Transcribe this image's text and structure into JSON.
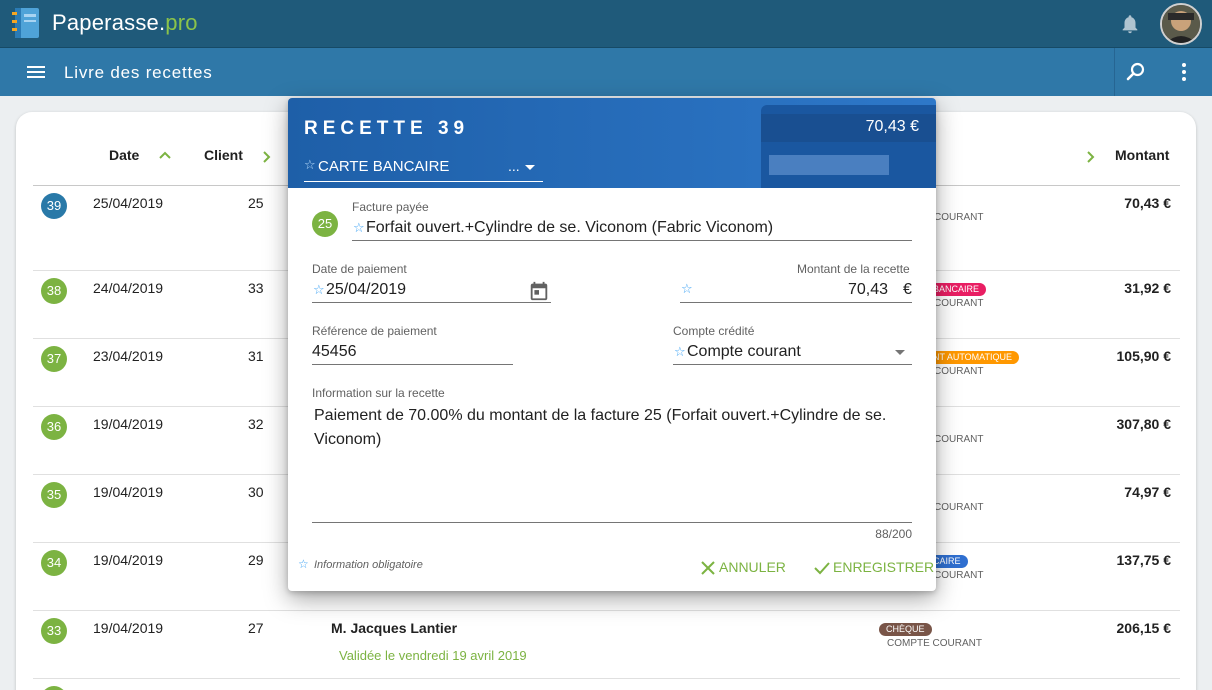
{
  "app": {
    "brand_main": "Paperasse.",
    "brand_accent": "pro",
    "page_title": "Livre des recettes"
  },
  "colors": {
    "topbar": "#1f5a7a",
    "toolbar": "#2f78a8",
    "accent_green": "#7cb342",
    "selected_blue": "#2979a8",
    "dialog_header": "#1e5fa8"
  },
  "table": {
    "headers": {
      "date": "Date",
      "client": "Client",
      "montant": "Montant"
    },
    "rows": [
      {
        "num": "39",
        "date": "25/04/2019",
        "client": "25",
        "amount": "70,43 €",
        "badge": "",
        "compte": "COURANT"
      },
      {
        "num": "38",
        "date": "24/04/2019",
        "client": "33",
        "amount": "31,92 €",
        "badge": "BANCAIRE",
        "compte": "COURANT"
      },
      {
        "num": "37",
        "date": "23/04/2019",
        "client": "31",
        "amount": "105,90 €",
        "badge": "NT AUTOMATIQUE",
        "compte": "COURANT"
      },
      {
        "num": "36",
        "date": "19/04/2019",
        "client": "32",
        "amount": "307,80 €",
        "badge": "",
        "compte": "COURANT"
      },
      {
        "num": "35",
        "date": "19/04/2019",
        "client": "30",
        "amount": "74,97 €",
        "badge": "",
        "compte": "COURANT"
      },
      {
        "num": "34",
        "date": "19/04/2019",
        "client": "29",
        "amount": "137,75 €",
        "badge": "CAIRE",
        "compte": "COURANT"
      },
      {
        "num": "33",
        "date": "19/04/2019",
        "client": "27",
        "amount": "206,15 €",
        "badge": "CHÈQUE",
        "compte": "COMPTE COURANT",
        "name": "M. Jacques Lantier",
        "status": "Validée le vendredi 19 avril 2019"
      }
    ]
  },
  "dialog": {
    "title": "RECETTE 39",
    "type_value": "CARTE BANCAIRE",
    "type_ellipsis": "...",
    "amount_header": "70,43 €",
    "invoice_number": "25",
    "fields": {
      "facture_label": "Facture payée",
      "facture_value": "Forfait ouvert.+Cylindre de se. Viconom (Fabric Viconom)",
      "date_label": "Date de paiement",
      "date_value": "25/04/2019",
      "montant_label": "Montant de la recette",
      "montant_value": "70,43",
      "montant_unit": "€",
      "reference_label": "Référence de paiement",
      "reference_value": "45456",
      "compte_label": "Compte crédité",
      "compte_value": "Compte courant",
      "info_label": "Information sur la recette",
      "info_value": "Paiement de 70.00% du montant de la facture 25 (Forfait ouvert.+Cylindre de se. Viconom)",
      "counter": "88/200"
    },
    "required_note": "Information obligatoire",
    "cancel_label": "ANNULER",
    "save_label": "ENREGISTRER"
  }
}
